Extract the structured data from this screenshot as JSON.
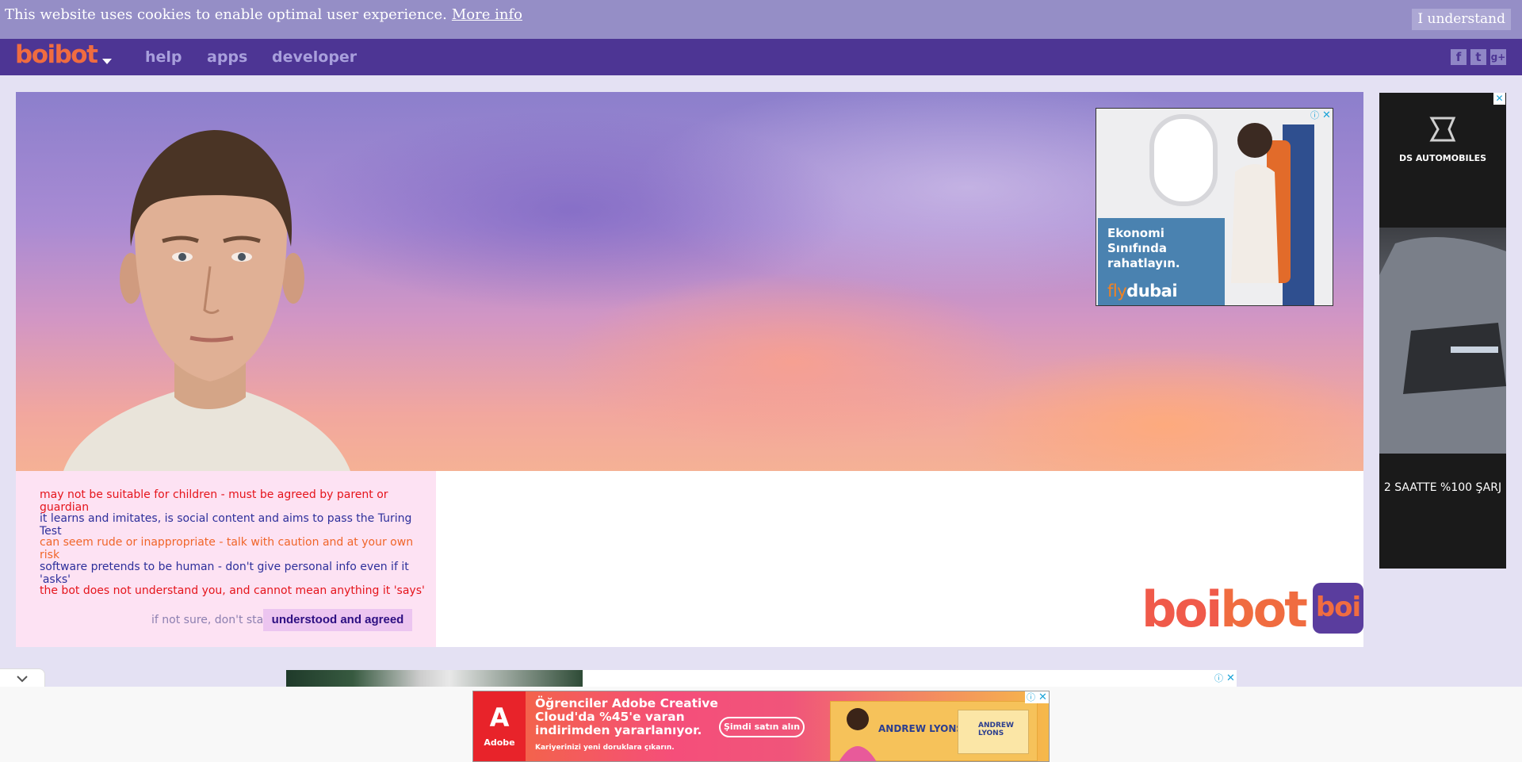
{
  "cookie_bar": {
    "message": "This website uses cookies to enable optimal user experience.",
    "more_info": "More info",
    "accept_button": "I understand"
  },
  "nav": {
    "logo": "boibot",
    "links": [
      "help",
      "apps",
      "developer"
    ],
    "social": {
      "facebook": "f",
      "twitter": "t",
      "google_plus": "g+"
    }
  },
  "disclaimer": {
    "lines": [
      "may not be suitable for children - must be agreed by parent or guardian",
      "it learns and imitates, is social content and aims to pass the Turing Test",
      "can seem rude or inappropriate - talk with caution and at your own risk",
      "software pretends to be human - don't give personal info even if it 'asks'",
      "the bot does not understand you, and cannot mean anything it 'says'"
    ],
    "not_sure": "if not sure, don't stay",
    "agree_button": "understood and agreed"
  },
  "brand": {
    "big_logo_left": "boi",
    "big_logo_right": "bot",
    "badge": "boi"
  },
  "ads": {
    "top_ad": {
      "headline": "Ekonomi Sınıfında rahatlayın.",
      "brand_fly": "fly",
      "brand_dubai": "dubai"
    },
    "side_ad": {
      "brand": "DS AUTOMOBILES",
      "text": "2 SAATTE %100 ŞARJ"
    },
    "bottom_ad": {
      "brand": "Adobe",
      "headline": "Öğrenciler Adobe Creative Cloud'da %45'e varan indirimden yararlanıyor.",
      "subline": "Kariyerinizi yeni doruklara çıkarın.",
      "cta": "Şimdi satın alın",
      "person_name": "ANDREW LYONS",
      "card_name": "ANDREW LYONS"
    }
  },
  "colors": {
    "nav_bg": "#4d3594",
    "cookie_bg": "#958ec6",
    "logo": "#f06c40",
    "disclaimer_bg": "#fde2f3"
  },
  "icons": {
    "collapse": "chevron-down-icon",
    "ad_info": "info-icon",
    "ad_close": "close-icon"
  }
}
